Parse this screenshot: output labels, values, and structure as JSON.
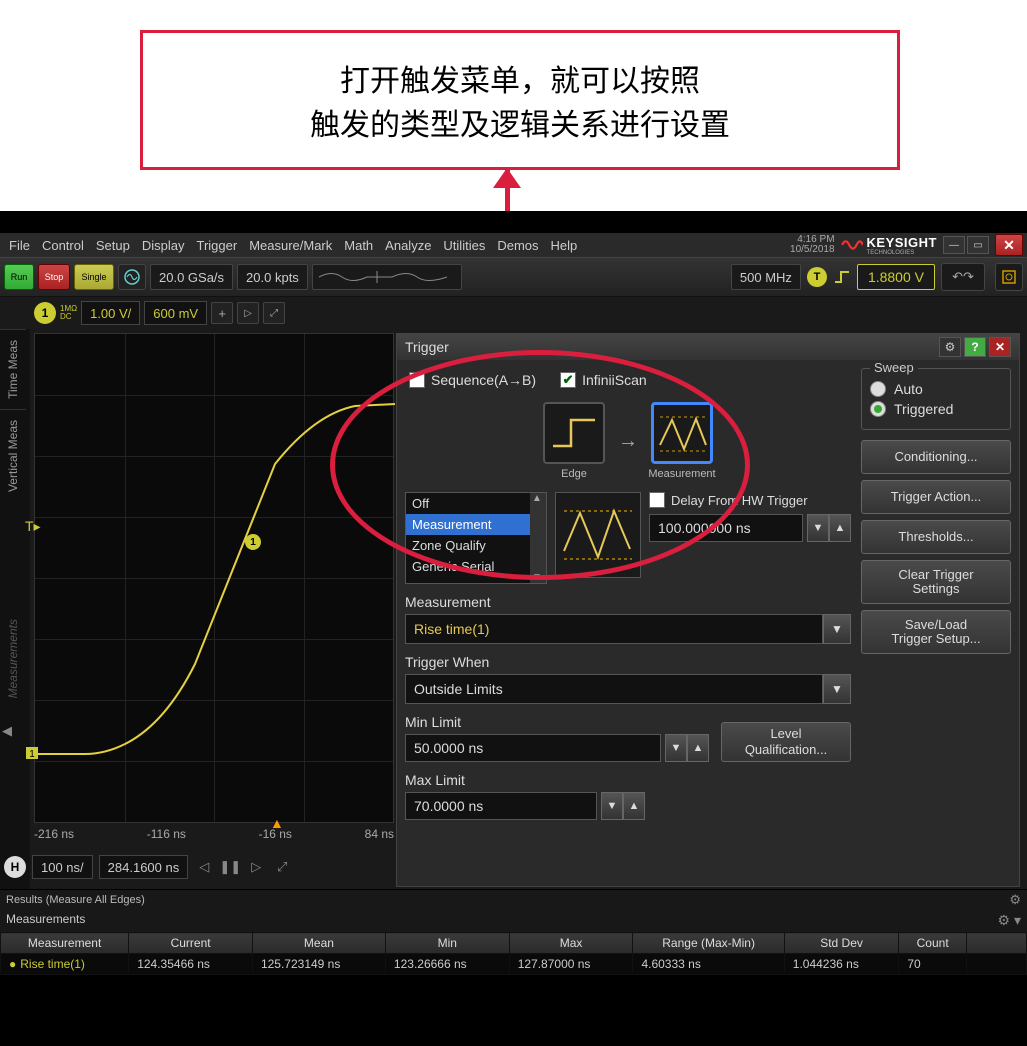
{
  "callout": {
    "line1": "打开触发菜单，就可以按照",
    "line2": "触发的类型及逻辑关系进行设置"
  },
  "menubar": {
    "items": [
      "File",
      "Control",
      "Setup",
      "Display",
      "Trigger",
      "Measure/Mark",
      "Math",
      "Analyze",
      "Utilities",
      "Demos",
      "Help"
    ],
    "time": "4:16 PM",
    "date": "10/5/2018",
    "brand": "KEYSIGHT",
    "brand_sub": "TECHNOLOGIES"
  },
  "toolbar": {
    "run": "Run",
    "stop": "Stop",
    "single": "Single",
    "sa_rate": "20.0 GSa/s",
    "pts": "20.0 kpts",
    "bw": "500 MHz",
    "trig_level": "1.8800 V"
  },
  "channel": {
    "num": "1",
    "coupling": "1MΩ\nDC",
    "scale": "1.00 V/",
    "offset": "600 mV"
  },
  "side": {
    "tab1": "Time Meas",
    "tab2": "Vertical Meas",
    "tab3": "Measurements"
  },
  "xaxis": {
    "t0": "-216 ns",
    "t1": "-116 ns",
    "t2": "-16 ns",
    "t3": "84 ns"
  },
  "timebar": {
    "scale": "100 ns/",
    "pos": "284.1600 ns"
  },
  "trigger": {
    "title": "Trigger",
    "seq_lbl": "Sequence(A→B)",
    "seq_checked": false,
    "inf_lbl": "InfiniiScan",
    "inf_checked": true,
    "flow_a": "Edge",
    "flow_b": "Measurement",
    "modes": [
      "Off",
      "Measurement",
      "Zone Qualify",
      "Generic Serial"
    ],
    "mode_selected": 1,
    "delay_lbl": "Delay From HW Trigger",
    "delay_checked": false,
    "delay_val": "100.000000 ns",
    "meas_lbl": "Measurement",
    "meas_val": "Rise time(1)",
    "when_lbl": "Trigger When",
    "when_val": "Outside Limits",
    "min_lbl": "Min Limit",
    "min_val": "50.0000 ns",
    "max_lbl": "Max Limit",
    "max_val": "70.0000 ns",
    "level_btn": "Level\nQualification...",
    "sweep_title": "Sweep",
    "sweep_auto": "Auto",
    "sweep_trig": "Triggered",
    "btn_cond": "Conditioning...",
    "btn_act": "Trigger Action...",
    "btn_thr": "Thresholds...",
    "btn_clr": "Clear Trigger\nSettings",
    "btn_save": "Save/Load\nTrigger Setup..."
  },
  "results": {
    "label": "Results  (Measure All Edges)"
  },
  "meas": {
    "title": "Measurements",
    "headers": [
      "Measurement",
      "Current",
      "Mean",
      "Min",
      "Max",
      "Range (Max-Min)",
      "Std Dev",
      "Count"
    ],
    "row": {
      "name": "Rise time(1)",
      "current": "124.35466 ns",
      "mean": "125.723149 ns",
      "min": "123.26666 ns",
      "max": "127.87000 ns",
      "range": "4.60333 ns",
      "std": "1.044236 ns",
      "count": "70"
    }
  }
}
